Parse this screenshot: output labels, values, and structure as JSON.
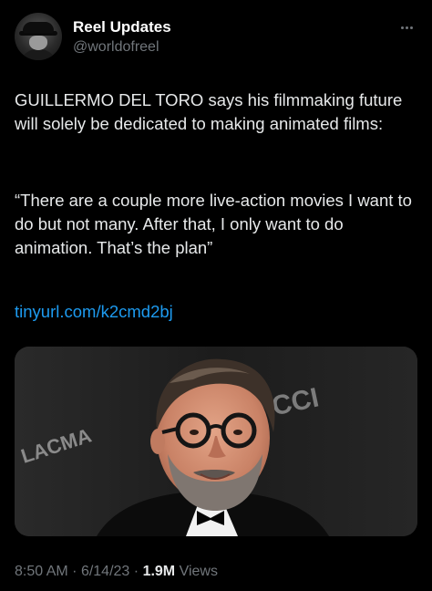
{
  "author": {
    "display_name": "Reel Updates",
    "handle": "@worldofreel"
  },
  "tweet": {
    "paragraph1": "GUILLERMO DEL TORO says his filmmaking future will solely be dedicated to making animated films:",
    "paragraph2": "“There are a couple more live-action movies I want to do but not many. After that, I only want to do animation. That’s the plan”",
    "link": "tinyurl.com/k2cmd2bj"
  },
  "photo": {
    "backdrop_text_left": "LACMA",
    "backdrop_text_right": "CCI"
  },
  "meta": {
    "time": "8:50 AM",
    "separator1": "·",
    "date": "6/14/23",
    "separator2": "·",
    "views_count": "1.9M",
    "views_label": "Views"
  },
  "icons": {
    "more": "more-horizontal-icon"
  },
  "colors": {
    "background": "#000000",
    "text": "#e7e9ea",
    "secondary": "#71767b",
    "link": "#1d9bf0"
  }
}
